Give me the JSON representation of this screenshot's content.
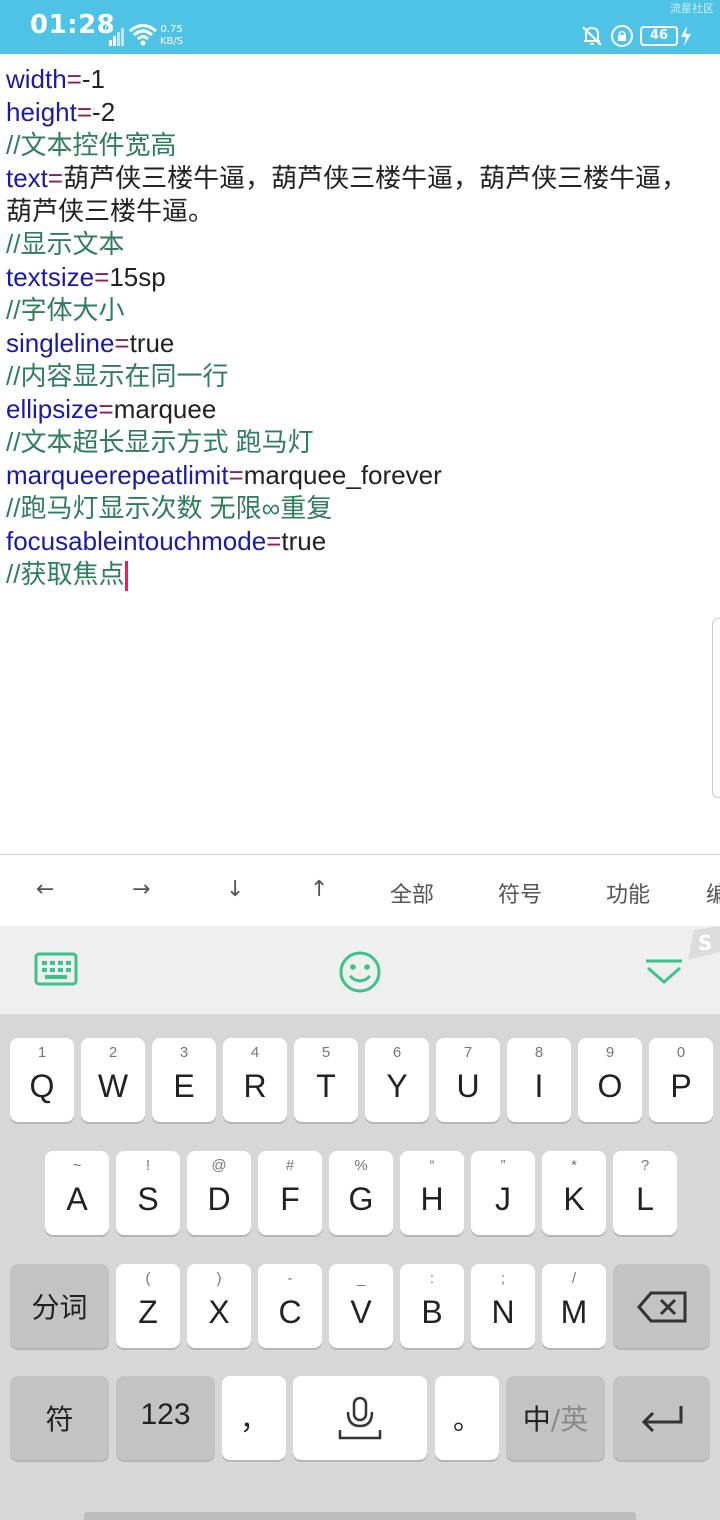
{
  "status_bar": {
    "time": "01:28",
    "network": "4G",
    "speed_value": "0.75",
    "speed_unit": "KB/S",
    "battery": "46",
    "corner_text": "流星社区"
  },
  "editor": {
    "lines": [
      {
        "key": "width",
        "eq": "=",
        "value": "-1"
      },
      {
        "key": "height",
        "eq": "=",
        "value": "-2"
      },
      {
        "comment": "//文本控件宽高"
      },
      {
        "key": "text",
        "eq": "=",
        "value": "葫芦侠三楼牛逼，葫芦侠三楼牛逼，葫芦侠三楼牛逼，葫芦侠三楼牛逼。"
      },
      {
        "comment": "//显示文本"
      },
      {
        "key": "textsize",
        "eq": "=",
        "value": "15sp"
      },
      {
        "comment": "//字体大小"
      },
      {
        "key": "singleline",
        "eq": "=",
        "value": "true"
      },
      {
        "comment": "//内容显示在同一行"
      },
      {
        "key": "ellipsize",
        "eq": "=",
        "value": "marquee"
      },
      {
        "comment": "//文本超长显示方式 跑马灯"
      },
      {
        "key": "marqueerepeatlimit",
        "eq": "=",
        "value": "marquee_forever"
      },
      {
        "comment": "//跑马灯显示次数 无限∞重复"
      },
      {
        "key": "focusableintouchmode",
        "eq": "=",
        "value": "true"
      },
      {
        "comment": "//获取焦点"
      }
    ]
  },
  "shortcut_bar": {
    "left": "←",
    "right": "→",
    "down": "↓",
    "up": "↑",
    "all": "全部",
    "symbols": "符号",
    "functions": "功能",
    "more": "编"
  },
  "keyboard": {
    "row1": [
      {
        "sub": "1",
        "main": "Q"
      },
      {
        "sub": "2",
        "main": "W"
      },
      {
        "sub": "3",
        "main": "E"
      },
      {
        "sub": "4",
        "main": "R"
      },
      {
        "sub": "5",
        "main": "T"
      },
      {
        "sub": "6",
        "main": "Y"
      },
      {
        "sub": "7",
        "main": "U"
      },
      {
        "sub": "8",
        "main": "I"
      },
      {
        "sub": "9",
        "main": "O"
      },
      {
        "sub": "0",
        "main": "P"
      }
    ],
    "row2": [
      {
        "sub": "~",
        "main": "A"
      },
      {
        "sub": "!",
        "main": "S"
      },
      {
        "sub": "@",
        "main": "D"
      },
      {
        "sub": "#",
        "main": "F"
      },
      {
        "sub": "%",
        "main": "G"
      },
      {
        "sub": "“",
        "main": "H"
      },
      {
        "sub": "”",
        "main": "J"
      },
      {
        "sub": "*",
        "main": "K"
      },
      {
        "sub": "?",
        "main": "L"
      }
    ],
    "row3": [
      {
        "sub": "(",
        "main": "Z"
      },
      {
        "sub": ")",
        "main": "X"
      },
      {
        "sub": "-",
        "main": "C"
      },
      {
        "sub": "_",
        "main": "V"
      },
      {
        "sub": ":",
        "main": "B"
      },
      {
        "sub": ";",
        "main": "N"
      },
      {
        "sub": "/",
        "main": "M"
      }
    ],
    "segment_label": "分词",
    "symbol_label": "符",
    "num_label": "123",
    "comma_label": "，",
    "period_label": "。",
    "lang_cn": "中",
    "lang_sep": "/",
    "lang_en": "英"
  },
  "colors": {
    "status_bar": "#4fc3e6",
    "keyword": "#1a1aa6",
    "comment": "#2e7d5b",
    "cursor": "#e91e63",
    "keyboard_green": "#3cc28a"
  }
}
